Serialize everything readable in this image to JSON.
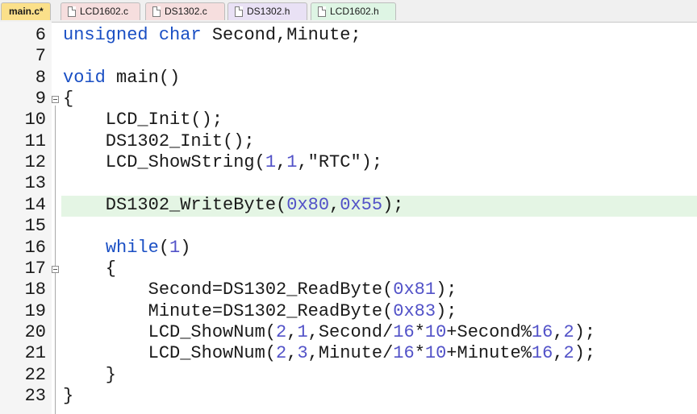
{
  "tabs": [
    {
      "label": "main.c*",
      "active": true
    },
    {
      "label": "LCD1602.c",
      "active": false
    },
    {
      "label": "DS1302.c",
      "active": false
    },
    {
      "label": "DS1302.h",
      "active": false
    },
    {
      "label": "LCD1602.h",
      "active": false
    }
  ],
  "colors": {
    "keyword": "#1a4fc4",
    "number": "#5252c8",
    "current_line": "#e4f5e4",
    "active_tab": "#fbe08a",
    "c_tab": "#f6dede",
    "h_tab": "#e9e1f5",
    "header_tab": "#def5e4"
  },
  "editor": {
    "lines": [
      {
        "num": "6",
        "tokens": [
          {
            "t": "unsigned",
            "k": "kw"
          },
          {
            "t": " "
          },
          {
            "t": "char",
            "k": "kw"
          },
          {
            "t": " Second,Minute;"
          }
        ]
      },
      {
        "num": "7",
        "tokens": []
      },
      {
        "num": "8",
        "tokens": [
          {
            "t": "void",
            "k": "kw"
          },
          {
            "t": " main()"
          }
        ]
      },
      {
        "num": "9",
        "tokens": [
          {
            "t": "{"
          }
        ]
      },
      {
        "num": "10",
        "tokens": [
          {
            "t": "    LCD_Init();"
          }
        ]
      },
      {
        "num": "11",
        "tokens": [
          {
            "t": "    DS1302_Init();"
          }
        ]
      },
      {
        "num": "12",
        "tokens": [
          {
            "t": "    LCD_ShowString("
          },
          {
            "t": "1",
            "k": "num"
          },
          {
            "t": ","
          },
          {
            "t": "1",
            "k": "num"
          },
          {
            "t": ","
          },
          {
            "t": "\"RTC\"",
            "k": "str"
          },
          {
            "t": ");"
          }
        ]
      },
      {
        "num": "13",
        "tokens": []
      },
      {
        "num": "14",
        "tokens": [
          {
            "t": "    DS1302_WriteByte("
          },
          {
            "t": "0x80",
            "k": "num"
          },
          {
            "t": ","
          },
          {
            "t": "0x55",
            "k": "num"
          },
          {
            "t": ");"
          }
        ]
      },
      {
        "num": "15",
        "tokens": []
      },
      {
        "num": "16",
        "tokens": [
          {
            "t": "    "
          },
          {
            "t": "while",
            "k": "kw"
          },
          {
            "t": "("
          },
          {
            "t": "1",
            "k": "num"
          },
          {
            "t": ")"
          }
        ]
      },
      {
        "num": "17",
        "tokens": [
          {
            "t": "    {"
          }
        ]
      },
      {
        "num": "18",
        "tokens": [
          {
            "t": "        Second=DS1302_ReadByte("
          },
          {
            "t": "0x81",
            "k": "num"
          },
          {
            "t": ");"
          }
        ]
      },
      {
        "num": "19",
        "tokens": [
          {
            "t": "        Minute=DS1302_ReadByte("
          },
          {
            "t": "0x83",
            "k": "num"
          },
          {
            "t": ");"
          }
        ]
      },
      {
        "num": "20",
        "tokens": [
          {
            "t": "        LCD_ShowNum("
          },
          {
            "t": "2",
            "k": "num"
          },
          {
            "t": ","
          },
          {
            "t": "1",
            "k": "num"
          },
          {
            "t": ",Second/"
          },
          {
            "t": "16",
            "k": "num"
          },
          {
            "t": "*"
          },
          {
            "t": "10",
            "k": "num"
          },
          {
            "t": "+Second%"
          },
          {
            "t": "16",
            "k": "num"
          },
          {
            "t": ","
          },
          {
            "t": "2",
            "k": "num"
          },
          {
            "t": ");"
          }
        ]
      },
      {
        "num": "21",
        "tokens": [
          {
            "t": "        LCD_ShowNum("
          },
          {
            "t": "2",
            "k": "num"
          },
          {
            "t": ","
          },
          {
            "t": "3",
            "k": "num"
          },
          {
            "t": ",Minute/"
          },
          {
            "t": "16",
            "k": "num"
          },
          {
            "t": "*"
          },
          {
            "t": "10",
            "k": "num"
          },
          {
            "t": "+Minute%"
          },
          {
            "t": "16",
            "k": "num"
          },
          {
            "t": ","
          },
          {
            "t": "2",
            "k": "num"
          },
          {
            "t": ");"
          }
        ]
      },
      {
        "num": "22",
        "tokens": [
          {
            "t": "    }"
          }
        ]
      },
      {
        "num": "23",
        "tokens": [
          {
            "t": "}"
          }
        ]
      }
    ]
  }
}
